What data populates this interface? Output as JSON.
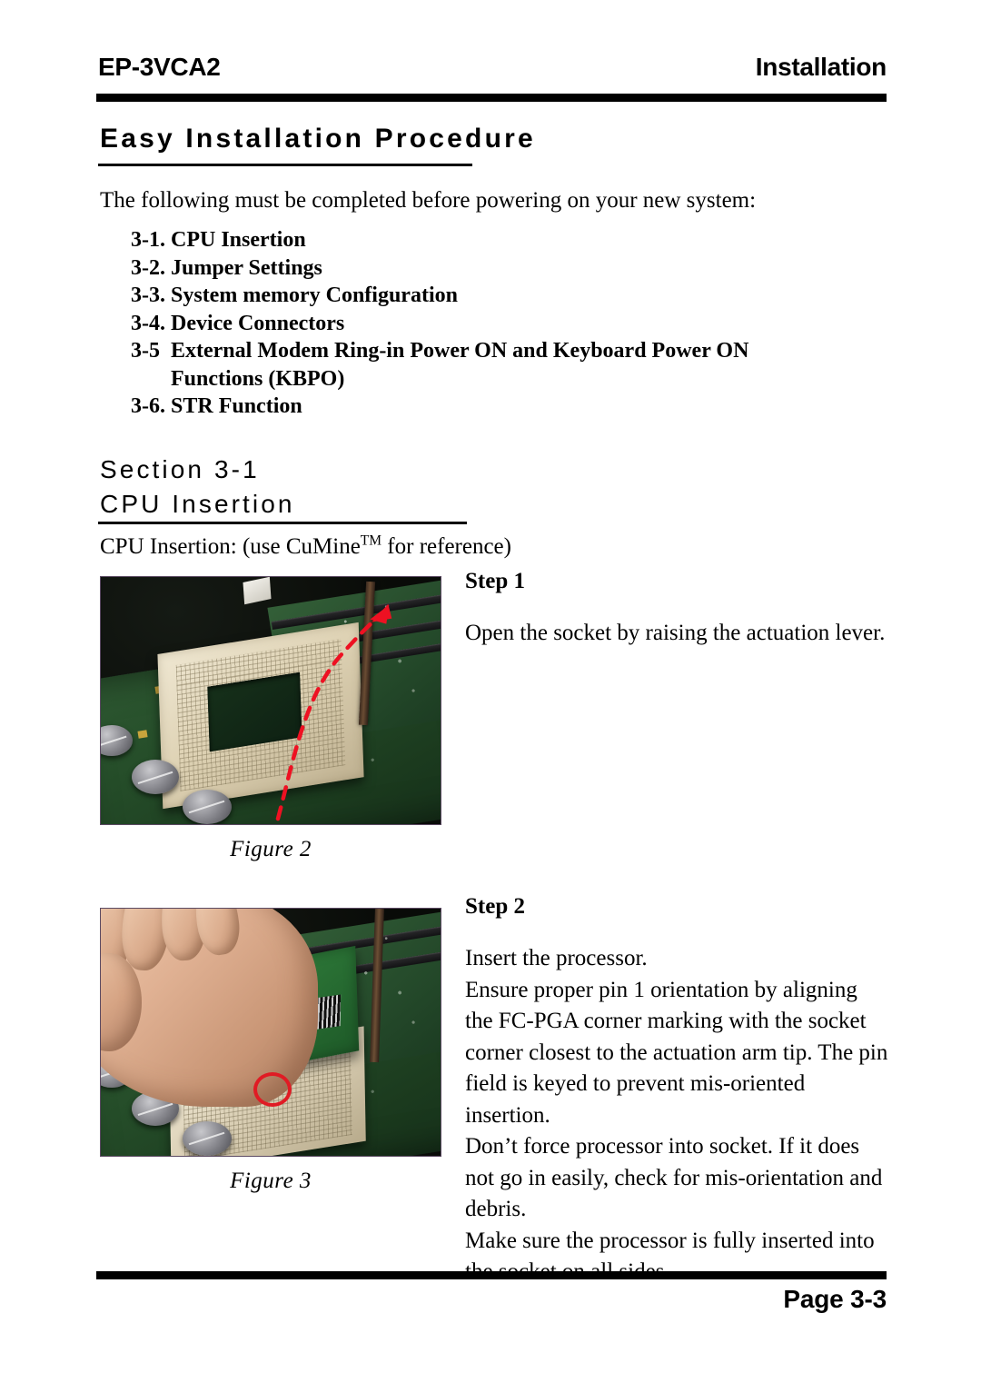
{
  "header": {
    "model": "EP-3VCA2",
    "section": "Installation"
  },
  "title": "Easy Installation Procedure",
  "intro": "The following must be completed before powering on your new system:",
  "procedure_items": [
    {
      "number": "3-1.",
      "label": "CPU Insertion"
    },
    {
      "number": "3-2.",
      "label": "Jumper Settings"
    },
    {
      "number": "3-3.",
      "label": "System memory Configuration"
    },
    {
      "number": "3-4.",
      "label": "Device Connectors"
    },
    {
      "number": "3-5",
      "label": "External Modem Ring-in Power ON and Keyboard Power ON Functions (KBPO)"
    },
    {
      "number": "3-6.",
      "label": "STR Function"
    }
  ],
  "section_heading": {
    "line1": "Section 3-1",
    "line2": "CPU Insertion"
  },
  "lead_in": {
    "before": "CPU Insertion: (use CuMine",
    "superscript": "TM",
    "after": " for reference)"
  },
  "figures": [
    {
      "caption": "Figure 2",
      "alt": "Photo of Socket 370 on motherboard with red dashed arrow showing the actuation lever being raised"
    },
    {
      "caption": "Figure 3",
      "alt": "Photo of a hand inserting an FC-PGA processor into the socket with red circle marking the pin 1 corner"
    }
  ],
  "steps": [
    {
      "heading": "Step 1",
      "paragraphs": [
        "Open the socket by raising the actuation lever."
      ]
    },
    {
      "heading": "Step 2",
      "paragraphs": [
        "Insert the processor.",
        "Ensure proper pin 1 orientation by aligning the FC-PGA corner marking with the socket corner closest to the actuation arm tip. The pin field is keyed to prevent mis-oriented insertion.",
        "Don’t force processor into socket. If it does not go in easily, check for mis-orientation and debris.",
        "Make sure the processor is fully inserted into the socket on all sides."
      ]
    }
  ],
  "footer": {
    "page_label": "Page 3-3"
  },
  "colors": {
    "ink": "#000000",
    "paper": "#ffffff",
    "annotation_red": "#e01b24"
  }
}
